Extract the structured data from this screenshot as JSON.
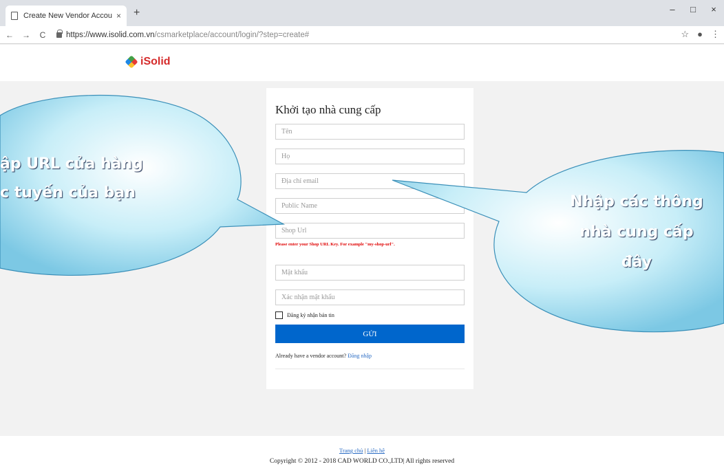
{
  "browser": {
    "tab_title": "Create New Vendor Account",
    "tab_close": "×",
    "new_tab": "+",
    "win_min": "–",
    "win_max": "□",
    "win_close": "×",
    "back": "←",
    "forward": "→",
    "reload": "C",
    "url_host": "https://www.isolid.com.vn",
    "url_path": "/csmarketplace/account/login/?step=create#",
    "star": "☆",
    "profile": "●",
    "menu": "⋮"
  },
  "header": {
    "logo_text": "iSolid"
  },
  "form": {
    "title": "Khởi tạo nhà cung cấp",
    "first_name_placeholder": "Tên",
    "last_name_placeholder": "Họ",
    "email_placeholder": "Địa chỉ email",
    "public_name_placeholder": "Public Name",
    "shop_url_placeholder": "Shop Url",
    "shop_url_error": "Please enter your Shop URL Key. For example \"my-shop-url\".",
    "password_placeholder": "Mật khẩu",
    "confirm_password_placeholder": "Xác nhận mật khẩu",
    "newsletter_label": "Đăng ký nhận bản tin",
    "submit_label": "GỬI",
    "already_text": "Already have a vendor account?",
    "login_link": "Đăng nhập"
  },
  "footer": {
    "home_link": "Trang chủ",
    "separator": "|",
    "contact_link": "Liên hệ",
    "copyright": "Copyright © 2012 - 2018 CAD WORLD CO.,LTD| All rights reserved"
  },
  "callouts": {
    "left_line1": "ập URL cửa hàng",
    "left_line2": "c tuyến của bạn",
    "right_line1": "Nhập các thông",
    "right_line2": "nhà cung cấp",
    "right_line3": "đây"
  },
  "colors": {
    "accent": "#0066cc",
    "error": "#e00000",
    "bubble_fill": "#8fd3e8"
  }
}
